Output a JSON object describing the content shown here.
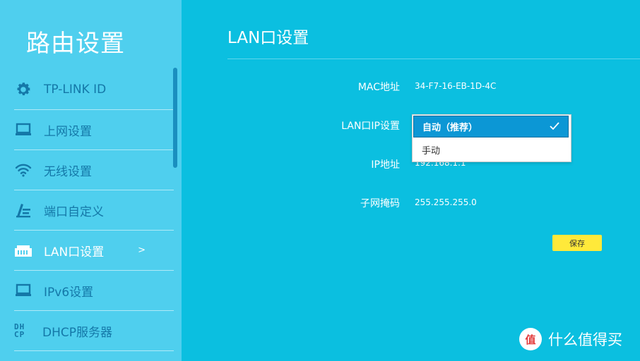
{
  "sidebar": {
    "title": "路由设置",
    "items": [
      {
        "label": "TP-LINK ID",
        "icon": "gear-icon"
      },
      {
        "label": "上网设置",
        "icon": "laptop-icon"
      },
      {
        "label": "无线设置",
        "icon": "wifi-icon"
      },
      {
        "label": "端口自定义",
        "icon": "port-edit-icon"
      },
      {
        "label": "LAN口设置",
        "icon": "lan-port-icon",
        "active": true,
        "arrow": ">"
      },
      {
        "label": "IPv6设置",
        "icon": "laptop-icon"
      },
      {
        "label": "DHCP服务器",
        "icon": "dhcp-icon",
        "icon_text": "DH CP"
      }
    ]
  },
  "main": {
    "title": "LAN口设置",
    "fields": {
      "mac_label": "MAC地址",
      "mac_value": "34-F7-16-EB-1D-4C",
      "ip_mode_label": "LAN口IP设置",
      "ip_label": "IP地址",
      "ip_value": "192.168.1.1",
      "mask_label": "子网掩码",
      "mask_value": "255.255.255.0"
    },
    "dropdown": {
      "selected": "自动（推荐）",
      "options": [
        "自动（推荐）",
        "手动"
      ]
    },
    "save_label": "保存"
  },
  "watermark": {
    "logo_text": "值",
    "text": "什么值得买"
  },
  "colors": {
    "sidebar_bg": "#4fcfee",
    "main_bg": "#0bbfe0",
    "sidebar_text": "#1478a8",
    "dropdown_highlight": "#0c97d5",
    "save_button": "#ffe93a"
  }
}
